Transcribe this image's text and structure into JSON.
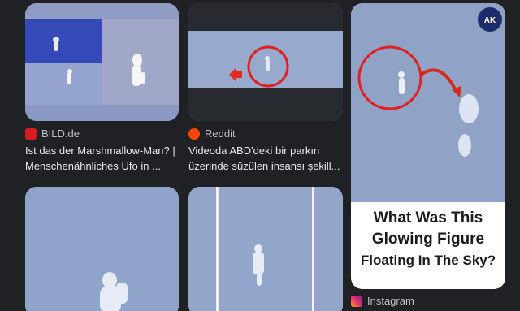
{
  "results": [
    {
      "source": "BILD.de",
      "title_line1": "Ist das der Marshmallow-Man? |",
      "title_line2": "Menschenähnliches Ufo in ...",
      "favicon_color": "#d81b20"
    },
    {
      "source": "Reddit",
      "title_line1": "Videoda ABD'deki bir parkın",
      "title_line2": "üzerinde süzülen insansı şekill...",
      "favicon_color": "#ff4500"
    },
    {
      "source": "Instagram",
      "overlay_line1": "What Was This",
      "overlay_line2": "Glowing Figure",
      "overlay_line3": "Floating In The Sky?",
      "badge_text": "AK",
      "favicon_color": "#e1306c"
    },
    {},
    {}
  ],
  "colors": {
    "background": "#202124",
    "sky": "#8ea2c5",
    "highlight_circle": "#e02020",
    "arrow": "#d62a1c"
  }
}
